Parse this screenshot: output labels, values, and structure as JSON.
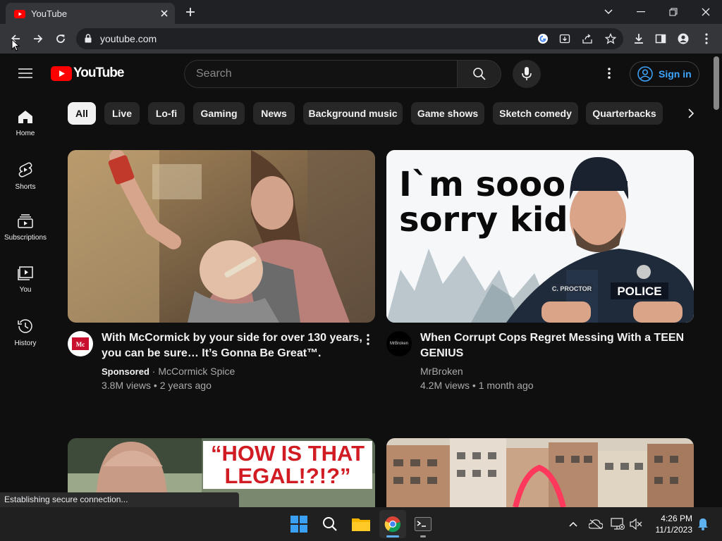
{
  "browser": {
    "tab_title": "YouTube",
    "url": "youtube.com"
  },
  "masthead": {
    "logo_text": "YouTube",
    "search_placeholder": "Search",
    "signin_label": "Sign in"
  },
  "sidebar": {
    "items": [
      {
        "label": "Home",
        "icon": "home-icon"
      },
      {
        "label": "Shorts",
        "icon": "shorts-icon"
      },
      {
        "label": "Subscriptions",
        "icon": "subscriptions-icon"
      },
      {
        "label": "You",
        "icon": "you-icon"
      },
      {
        "label": "History",
        "icon": "history-icon"
      }
    ]
  },
  "chips": [
    "All",
    "Live",
    "Lo-fi",
    "Gaming",
    "News",
    "Background music",
    "Game shows",
    "Sketch comedy",
    "Quarterbacks"
  ],
  "videos": [
    {
      "title_line1": "With McCormick by your side for over 130 years,",
      "title_line2": "you can be sure… It’s Gonna Be Great™.",
      "sponsored": "Sponsored",
      "channel": "McCormick Spice",
      "stats": "3.8M views • 2 years ago",
      "avatar_text": "McCormick"
    },
    {
      "title_line1": "When Corrupt Cops Regret Messing With a TEEN",
      "title_line2": "GENIUS",
      "channel": "MrBroken",
      "stats": "4.2M views • 1 month ago",
      "avatar_text": "MrBroken",
      "thumb_text_line1": "I`m sooo",
      "thumb_text_line2": "sorry kid",
      "thumb_badge": "POLICE",
      "thumb_nametag": "C. PROCTOR"
    },
    {
      "thumb_text_line1": "“HOW IS THAT",
      "thumb_text_line2": "LEGAL!?!?”"
    },
    {}
  ],
  "status_text": "Establishing secure connection...",
  "taskbar": {
    "time": "4:26 PM",
    "date": "11/1/2023"
  },
  "colors": {
    "youtube_red": "#ff0000",
    "link_blue": "#3ea6ff",
    "bg": "#0f0f0f"
  }
}
